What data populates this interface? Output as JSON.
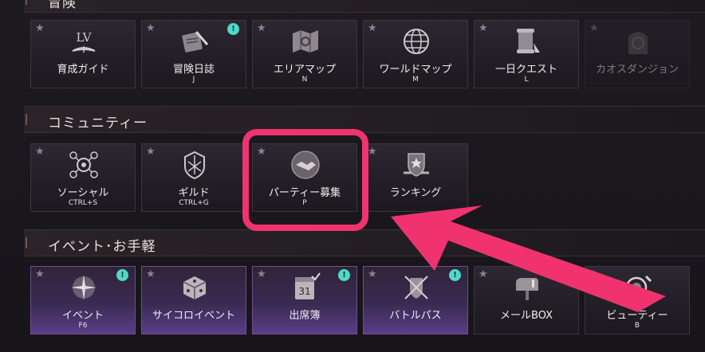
{
  "sections": {
    "adventure": {
      "title": "冒険",
      "tiles": [
        {
          "label": "育成ガイド",
          "key": "",
          "icon": "level-book-icon",
          "notify": false
        },
        {
          "label": "冒険日誌",
          "key": "J",
          "icon": "journal-quill-icon",
          "notify": true
        },
        {
          "label": "エリアマップ",
          "key": "N",
          "icon": "area-map-icon",
          "notify": false
        },
        {
          "label": "ワールドマップ",
          "key": "M",
          "icon": "globe-icon",
          "notify": false
        },
        {
          "label": "一日クエスト",
          "key": "L",
          "icon": "quest-scroll-icon",
          "notify": false
        },
        {
          "label": "カオスダンジョン",
          "key": "",
          "icon": "chaos-dungeon-icon",
          "notify": false,
          "disabled": true
        }
      ]
    },
    "community": {
      "title": "コミュニティー",
      "tiles": [
        {
          "label": "ソーシャル",
          "key": "CTRL+S",
          "icon": "social-network-icon",
          "notify": false
        },
        {
          "label": "ギルド",
          "key": "CTRL+G",
          "icon": "guild-crest-icon",
          "notify": false
        },
        {
          "label": "パーティー募集",
          "key": "P",
          "icon": "handshake-icon",
          "notify": false
        },
        {
          "label": "ランキング",
          "key": "",
          "icon": "ranking-shield-icon",
          "notify": false
        }
      ]
    },
    "events": {
      "title": "イベント･お手軽",
      "tiles": [
        {
          "label": "イベント",
          "key": "F6",
          "icon": "event-sparkle-icon",
          "notify": true
        },
        {
          "label": "サイコロイベント",
          "key": "",
          "icon": "dice-icon",
          "notify": false
        },
        {
          "label": "出席簿",
          "key": "",
          "icon": "calendar-icon",
          "notify": true,
          "calendar_day": "31"
        },
        {
          "label": "バトルパス",
          "key": "",
          "icon": "battle-pass-icon",
          "notify": true
        },
        {
          "label": "メールBOX",
          "key": "",
          "icon": "mailbox-icon",
          "notify": false
        },
        {
          "label": "ビューティー",
          "key": "B",
          "icon": "beauty-mirror-icon",
          "notify": false
        }
      ]
    }
  },
  "glyphs": {
    "star": "★",
    "notify": "!"
  },
  "colors": {
    "highlight": "#f0336f",
    "notify": "#4fd9c9",
    "purple_tile": "#5a3d87"
  }
}
